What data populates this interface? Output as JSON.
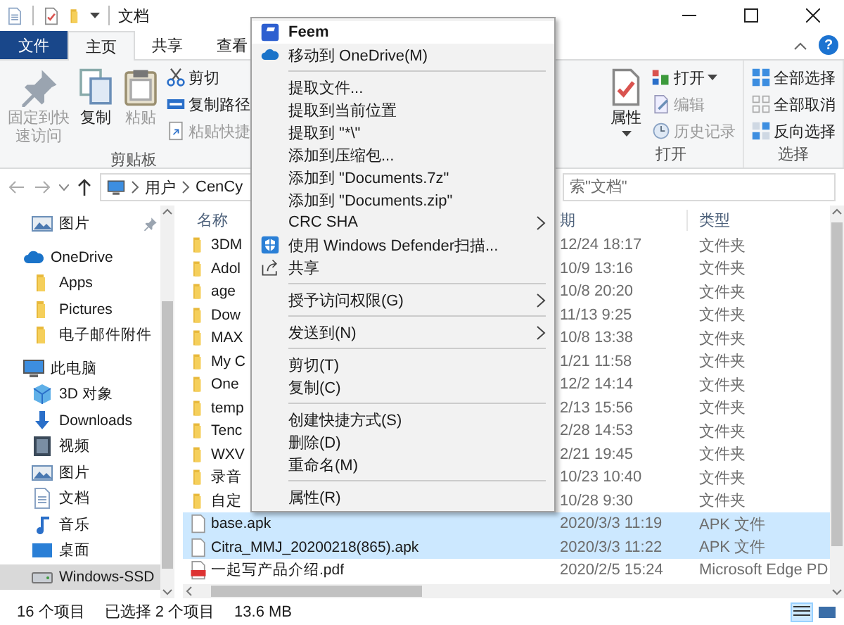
{
  "window": {
    "title": "文档"
  },
  "ribbon": {
    "tabs": [
      {
        "label": "文件",
        "kind": "file",
        "selected": false
      },
      {
        "label": "主页",
        "kind": "tab",
        "selected": true
      },
      {
        "label": "共享",
        "kind": "tab",
        "selected": false
      },
      {
        "label": "查看",
        "kind": "tab",
        "selected": false
      }
    ],
    "help": "?",
    "groups": [
      {
        "label": "剪贴板",
        "items": [
          {
            "label": "固定到快速访问",
            "kind": "pin",
            "disabled": true,
            "dropdown": false
          },
          {
            "label": "复制",
            "kind": "copy",
            "disabled": false,
            "dropdown": false
          },
          {
            "label": "粘贴",
            "kind": "paste",
            "disabled": true,
            "dropdown": false
          },
          {
            "label": "剪切",
            "kind": "cut",
            "disabled": false,
            "dropdown": false
          },
          {
            "label": "复制路径",
            "kind": "copypath",
            "disabled": false,
            "dropdown": false
          },
          {
            "label": "粘贴快捷",
            "kind": "shortcut",
            "disabled": true,
            "dropdown": false
          }
        ]
      },
      {
        "label": "打开",
        "items": [
          {
            "label": "属性",
            "kind": "properties",
            "disabled": false,
            "dropdown": true
          },
          {
            "label": "打开",
            "kind": "open",
            "disabled": false,
            "dropdown": true
          },
          {
            "label": "编辑",
            "kind": "edit",
            "disabled": true,
            "dropdown": false
          },
          {
            "label": "历史记录",
            "kind": "history",
            "disabled": true,
            "dropdown": false
          }
        ]
      },
      {
        "label": "选择",
        "items": [
          {
            "label": "全部选择",
            "kind": "selectall",
            "disabled": false,
            "dropdown": false
          },
          {
            "label": "全部取消",
            "kind": "selectnone",
            "disabled": false,
            "dropdown": false
          },
          {
            "label": "反向选择",
            "kind": "invert",
            "disabled": false,
            "dropdown": false
          }
        ]
      }
    ]
  },
  "navigation": {
    "path": [
      "用户",
      "CenCy"
    ],
    "search": {
      "placeholder": "索\"文档\""
    }
  },
  "sidebar": {
    "items": [
      {
        "label": "图片",
        "kind": "pictures",
        "pinned": true,
        "selected": false
      },
      {
        "label": "OneDrive",
        "kind": "cloud",
        "pinned": false,
        "selected": false,
        "children": [
          {
            "label": "Apps",
            "kind": "folder",
            "pinned": false,
            "selected": false
          },
          {
            "label": "Pictures",
            "kind": "folder",
            "pinned": false,
            "selected": false
          },
          {
            "label": "电子邮件附件",
            "kind": "folder",
            "pinned": false,
            "selected": false
          }
        ]
      },
      {
        "label": "此电脑",
        "kind": "pc",
        "pinned": false,
        "selected": false,
        "children": [
          {
            "label": "3D 对象",
            "kind": "cube",
            "pinned": false,
            "selected": false
          },
          {
            "label": "Downloads",
            "kind": "download",
            "pinned": false,
            "selected": false
          },
          {
            "label": "视频",
            "kind": "video",
            "pinned": false,
            "selected": false
          },
          {
            "label": "图片",
            "kind": "pictures",
            "pinned": false,
            "selected": false
          },
          {
            "label": "文档",
            "kind": "doc",
            "pinned": false,
            "selected": false
          },
          {
            "label": "音乐",
            "kind": "music",
            "pinned": false,
            "selected": false
          },
          {
            "label": "桌面",
            "kind": "desktop",
            "pinned": false,
            "selected": false
          },
          {
            "label": "Windows-SSD",
            "kind": "drive",
            "pinned": false,
            "selected": true
          }
        ]
      }
    ]
  },
  "file_list": {
    "columns": [
      "名称",
      "期",
      "类型"
    ],
    "rows": [
      {
        "name": "3DM",
        "date": "12/24 18:17",
        "type": "文件夹",
        "kind": "folder",
        "selected": false
      },
      {
        "name": "Adol",
        "date": "10/9 13:16",
        "type": "文件夹",
        "kind": "folder",
        "selected": false
      },
      {
        "name": "age",
        "date": "10/8 20:20",
        "type": "文件夹",
        "kind": "folder",
        "selected": false
      },
      {
        "name": "Dow",
        "date": "11/13 9:25",
        "type": "文件夹",
        "kind": "folder",
        "selected": false
      },
      {
        "name": "MAX",
        "date": "10/8 13:38",
        "type": "文件夹",
        "kind": "folder",
        "selected": false
      },
      {
        "name": "My C",
        "date": "1/21 11:58",
        "type": "文件夹",
        "kind": "folder",
        "selected": false
      },
      {
        "name": "One",
        "date": "12/2 14:14",
        "type": "文件夹",
        "kind": "folder",
        "selected": false
      },
      {
        "name": "temp",
        "date": "2/13 15:56",
        "type": "文件夹",
        "kind": "folder",
        "selected": false
      },
      {
        "name": "Tenc",
        "date": "2/28 14:53",
        "type": "文件夹",
        "kind": "folder",
        "selected": false
      },
      {
        "name": "WXV",
        "date": "2/21 19:45",
        "type": "文件夹",
        "kind": "folder",
        "selected": false
      },
      {
        "name": "录音",
        "date": "10/23 10:40",
        "type": "文件夹",
        "kind": "folder",
        "selected": false
      },
      {
        "name": "自定",
        "date": "10/28 9:30",
        "type": "文件夹",
        "kind": "folder",
        "selected": false
      },
      {
        "name": "base.apk",
        "date": "2020/3/3 11:19",
        "type": "APK 文件",
        "kind": "file",
        "selected": true
      },
      {
        "name": "Citra_MMJ_20200218(865).apk",
        "date": "2020/3/3 11:22",
        "type": "APK 文件",
        "kind": "file",
        "selected": true
      },
      {
        "name": "一起写产品介绍.pdf",
        "date": "2020/2/5 15:24",
        "type": "Microsoft Edge PD",
        "kind": "pdf",
        "selected": false
      }
    ]
  },
  "context_menu": {
    "sections": [
      [
        {
          "label": "Feem",
          "kind": "feem",
          "submenu": false,
          "selected": true
        },
        {
          "label": "移动到 OneDrive(M)",
          "kind": "cloud",
          "submenu": false,
          "selected": false
        }
      ],
      [
        {
          "label": "提取文件...",
          "kind": "plain",
          "submenu": false,
          "selected": false
        },
        {
          "label": "提取到当前位置",
          "kind": "plain",
          "submenu": false,
          "selected": false
        },
        {
          "label": "提取到 \"*\\\"",
          "kind": "plain",
          "submenu": false,
          "selected": false
        },
        {
          "label": "添加到压缩包...",
          "kind": "plain",
          "submenu": false,
          "selected": false
        },
        {
          "label": "添加到 \"Documents.7z\"",
          "kind": "plain",
          "submenu": false,
          "selected": false
        },
        {
          "label": "添加到 \"Documents.zip\"",
          "kind": "plain",
          "submenu": false,
          "selected": false
        },
        {
          "label": "CRC SHA",
          "kind": "plain",
          "submenu": true,
          "selected": false
        },
        {
          "label": "使用 Windows Defender扫描...",
          "kind": "shield",
          "submenu": false,
          "selected": false
        },
        {
          "label": "共享",
          "kind": "share",
          "submenu": false,
          "selected": false
        }
      ],
      [
        {
          "label": "授予访问权限(G)",
          "kind": "plain",
          "submenu": true,
          "selected": false
        }
      ],
      [
        {
          "label": "发送到(N)",
          "kind": "plain",
          "submenu": true,
          "selected": false
        }
      ],
      [
        {
          "label": "剪切(T)",
          "kind": "plain",
          "submenu": false,
          "selected": false
        },
        {
          "label": "复制(C)",
          "kind": "plain",
          "submenu": false,
          "selected": false
        }
      ],
      [
        {
          "label": "创建快捷方式(S)",
          "kind": "plain",
          "submenu": false,
          "selected": false
        },
        {
          "label": "删除(D)",
          "kind": "plain",
          "submenu": false,
          "selected": false
        },
        {
          "label": "重命名(M)",
          "kind": "plain",
          "submenu": false,
          "selected": false
        }
      ],
      [
        {
          "label": "属性(R)",
          "kind": "plain",
          "submenu": false,
          "selected": false
        }
      ]
    ]
  },
  "status_bar": {
    "item_count": "16 个项目",
    "selection": "已选择 2 个项目",
    "size": "13.6 MB"
  }
}
